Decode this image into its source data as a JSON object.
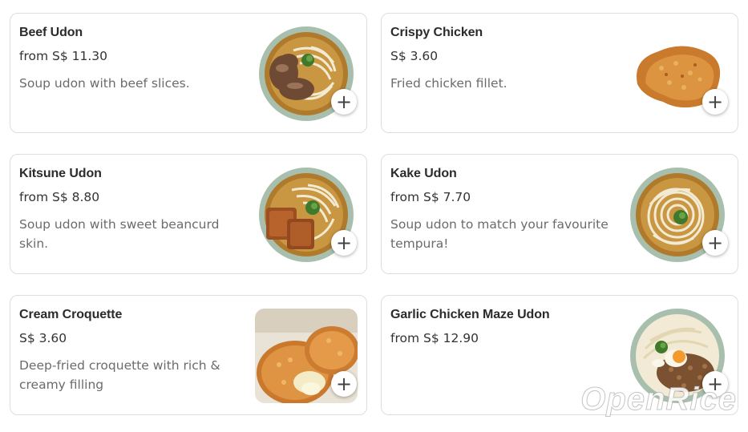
{
  "menu_items": [
    {
      "name": "Beef Udon",
      "price": "from S$ 11.30",
      "description": "Soup udon with beef slices.",
      "image": "beef-udon-bowl",
      "add_icon": "+"
    },
    {
      "name": "Crispy Chicken",
      "price": "S$ 3.60",
      "description": "Fried chicken fillet.",
      "image": "fried-chicken-fillet",
      "add_icon": "+"
    },
    {
      "name": "Kitsune Udon",
      "price": "from S$ 8.80",
      "description": "Soup udon with sweet beancurd skin.",
      "image": "kitsune-udon-bowl",
      "add_icon": "+"
    },
    {
      "name": "Kake Udon",
      "price": "from S$ 7.70",
      "description": "Soup udon to match your favourite tempura!",
      "image": "kake-udon-bowl",
      "add_icon": "+"
    },
    {
      "name": "Cream Croquette",
      "price": "S$ 3.60",
      "description": "Deep-fried croquette with rich & creamy filling",
      "image": "cream-croquette",
      "add_icon": "+"
    },
    {
      "name": "Garlic Chicken Maze Udon",
      "price": "from S$ 12.90",
      "description": "",
      "image": "garlic-chicken-maze-udon-bowl",
      "add_icon": "+"
    }
  ],
  "watermark": "OpenRice",
  "colors": {
    "border": "#dedede",
    "name": "#2b2b2b",
    "price": "#333333",
    "description": "#6b6b6b"
  }
}
